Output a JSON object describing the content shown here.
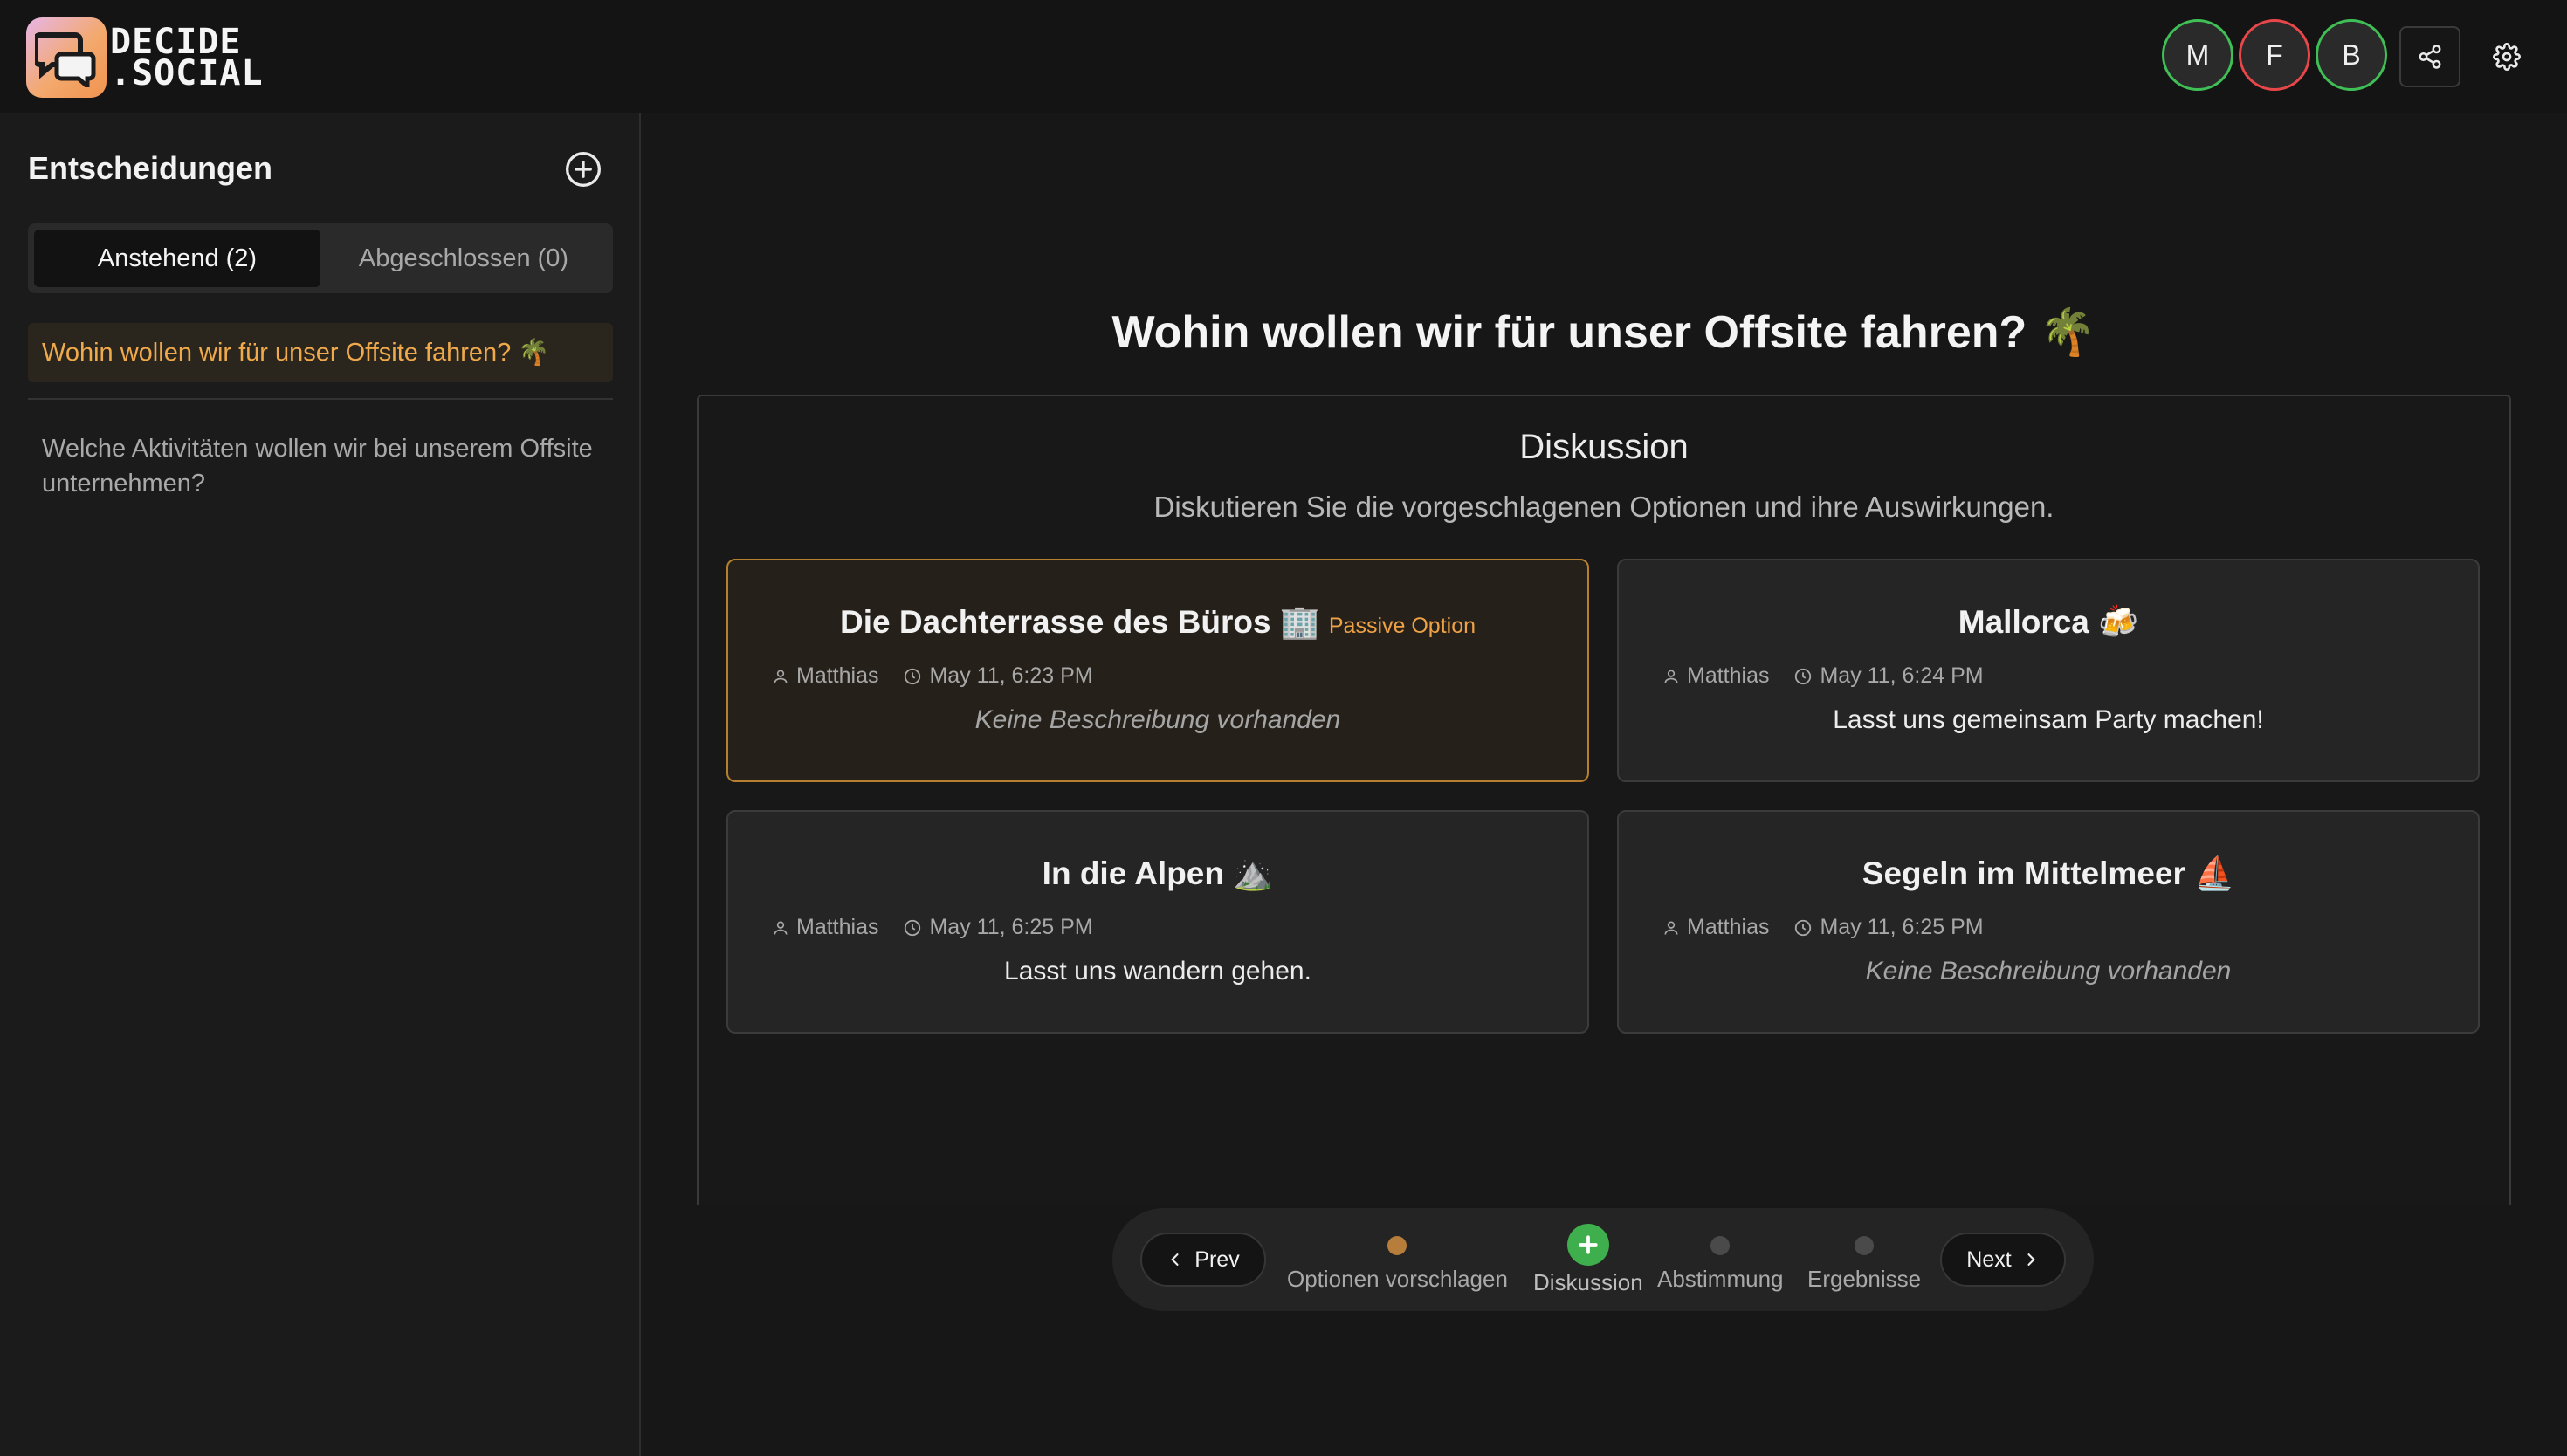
{
  "brand": {
    "line1": "DECIDE",
    "line2": ".SOCIAL"
  },
  "header": {
    "participants": [
      {
        "initial": "M",
        "status_color": "#3fbf55"
      },
      {
        "initial": "F",
        "status_color": "#e8474a"
      },
      {
        "initial": "B",
        "status_color": "#3fbf55"
      }
    ],
    "share_icon": "share-icon",
    "settings_icon": "gear-icon"
  },
  "sidebar": {
    "title": "Entscheidungen",
    "add_icon": "plus-circle-icon",
    "tabs": [
      {
        "label": "Anstehend (2)",
        "active": true
      },
      {
        "label": "Abgeschlossen (0)",
        "active": false
      }
    ],
    "decisions": [
      {
        "title": "Wohin wollen wir für unser Offsite fahren? 🌴",
        "active": true
      },
      {
        "title": "Welche Aktivitäten wollen wir bei unserem Offsite unternehmen?",
        "active": false
      }
    ]
  },
  "main": {
    "title": "Wohin wollen wir für unser Offsite fahren? 🌴",
    "phase": {
      "title": "Diskussion",
      "description": "Diskutieren Sie die vorgeschlagenen Optionen und ihre Auswirkungen."
    },
    "options": [
      {
        "title": "Die Dachterrasse des Büros 🏢",
        "tag": "Passive Option",
        "author": "Matthias",
        "time": "May 11, 6:23 PM",
        "description": "Keine Beschreibung vorhanden",
        "empty": true
      },
      {
        "title": "Mallorca 🍻",
        "tag": "",
        "author": "Matthias",
        "time": "May 11, 6:24 PM",
        "description": "Lasst uns gemeinsam Party machen!",
        "empty": false
      },
      {
        "title": "In die Alpen ⛰️",
        "tag": "",
        "author": "Matthias",
        "time": "May 11, 6:25 PM",
        "description": "Lasst uns wandern gehen.",
        "empty": false
      },
      {
        "title": "Segeln im Mittelmeer ⛵",
        "tag": "",
        "author": "Matthias",
        "time": "May 11, 6:25 PM",
        "description": "Keine Beschreibung vorhanden",
        "empty": true
      }
    ]
  },
  "stepper": {
    "prev_label": "Prev",
    "next_label": "Next",
    "steps": [
      {
        "label": "Optionen vorschlagen",
        "state": "done"
      },
      {
        "label": "Diskussion",
        "state": "current"
      },
      {
        "label": "Abstimmung",
        "state": "upcoming"
      },
      {
        "label": "Ergebnisse",
        "state": "upcoming"
      }
    ]
  },
  "colors": {
    "accent": "#f0a94b",
    "success": "#3fae4c",
    "danger": "#e8474a"
  }
}
